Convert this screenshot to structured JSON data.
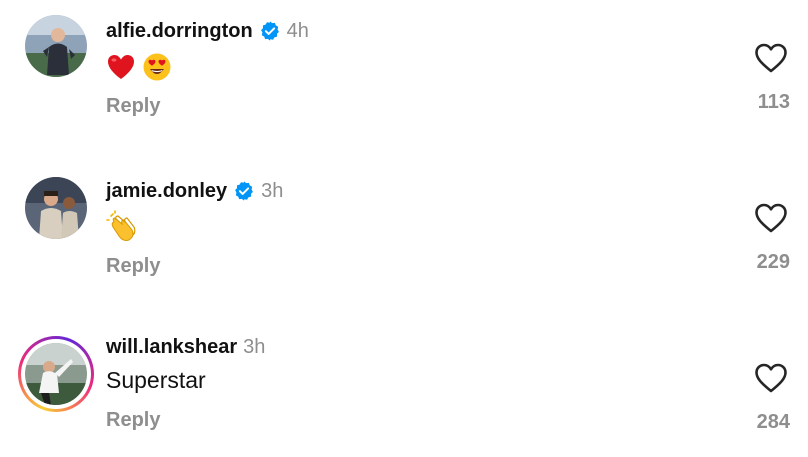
{
  "comments": [
    {
      "username": "alfie.dorrington",
      "verified": true,
      "time": "4h",
      "text": "",
      "emojis": [
        "red-heart-emoji",
        "heart-eyes-emoji"
      ],
      "reply_label": "Reply",
      "likes": "113"
    },
    {
      "username": "jamie.donley",
      "verified": true,
      "time": "3h",
      "text": "",
      "emojis": [
        "clapping-hands-emoji"
      ],
      "reply_label": "Reply",
      "likes": "229"
    },
    {
      "username": "will.lankshear",
      "verified": false,
      "has_story_ring": true,
      "time": "3h",
      "text": "Superstar",
      "emojis": [],
      "reply_label": "Reply",
      "likes": "284"
    }
  ],
  "colors": {
    "verified_blue": "#0095f6",
    "secondary_text": "#8e8e8e",
    "primary_text": "#111111"
  }
}
